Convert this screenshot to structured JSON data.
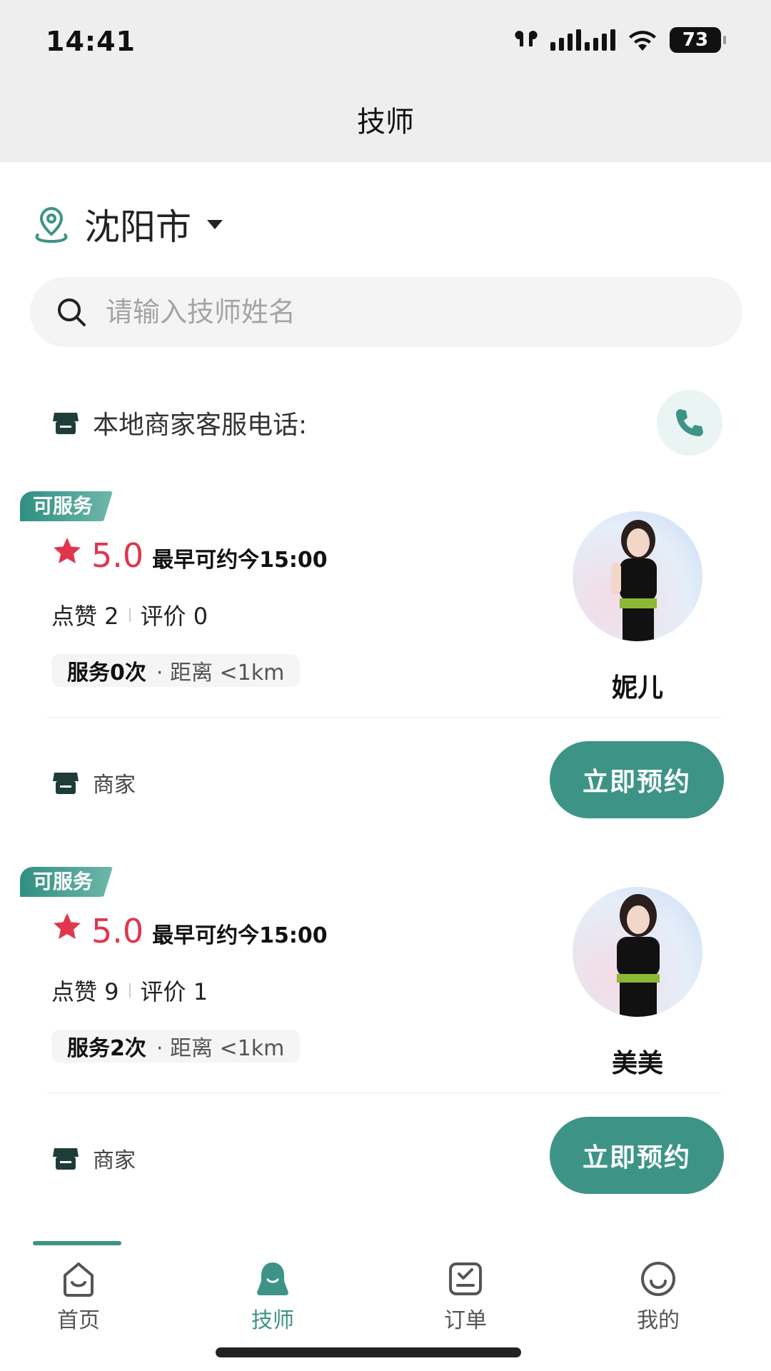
{
  "status_bar": {
    "time": "14:41",
    "battery": "73"
  },
  "header": {
    "title": "技师"
  },
  "location": {
    "city": "沈阳市"
  },
  "search": {
    "placeholder": "请输入技师姓名"
  },
  "hotline": {
    "label": "本地商家客服电话:"
  },
  "technicians": [
    {
      "tag": "可服务",
      "rating": "5.0",
      "earliest": "最早可约今15:00",
      "likes_label": "点赞 2",
      "reviews_label": "评价 0",
      "service_count": "服务0次",
      "distance": "· 距离 <1km",
      "name": "妮儿",
      "merchant": "商家",
      "book_label": "立即预约"
    },
    {
      "tag": "可服务",
      "rating": "5.0",
      "earliest": "最早可约今15:00",
      "likes_label": "点赞 9",
      "reviews_label": "评价 1",
      "service_count": "服务2次",
      "distance": "· 距离 <1km",
      "name": "美美",
      "merchant": "商家",
      "book_label": "立即预约"
    }
  ],
  "tabbar": {
    "items": [
      {
        "label": "首页",
        "icon": "home-icon"
      },
      {
        "label": "技师",
        "icon": "technician-icon",
        "active": true
      },
      {
        "label": "订单",
        "icon": "order-icon"
      },
      {
        "label": "我的",
        "icon": "profile-icon"
      }
    ]
  },
  "colors": {
    "accent": "#3d9486",
    "rating": "#e0364d",
    "header_bg": "#eeeeee"
  }
}
